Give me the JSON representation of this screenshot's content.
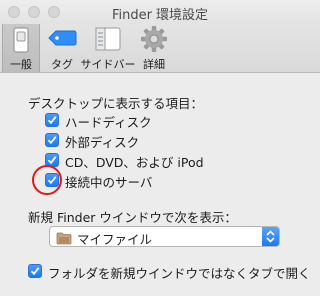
{
  "window": {
    "title": "Finder 環境設定"
  },
  "toolbar": {
    "items": [
      {
        "label": "一般",
        "icon": "general-switch-icon",
        "selected": true
      },
      {
        "label": "タグ",
        "icon": "tag-icon",
        "selected": false
      },
      {
        "label": "サイドバー",
        "icon": "sidebar-icon",
        "selected": false
      },
      {
        "label": "詳細",
        "icon": "gear-icon",
        "selected": false
      }
    ]
  },
  "desktop_items": {
    "heading": "デスクトップに表示する項目：",
    "options": [
      {
        "label": "ハードディスク",
        "checked": true
      },
      {
        "label": "外部ディスク",
        "checked": true
      },
      {
        "label": "CD、DVD、および iPod",
        "checked": true
      },
      {
        "label": "接続中のサーバ",
        "checked": true
      }
    ]
  },
  "new_window": {
    "heading": "新規 Finder ウインドウで次を表示：",
    "selected_value": "マイファイル",
    "icon": "folder-icon"
  },
  "open_in_tabs": {
    "label": "フォルダを新規ウインドウではなくタブで開く",
    "checked": true
  },
  "colors": {
    "accent": "#1f7bec",
    "annotation": "#e0181b",
    "background": "#ececec"
  }
}
